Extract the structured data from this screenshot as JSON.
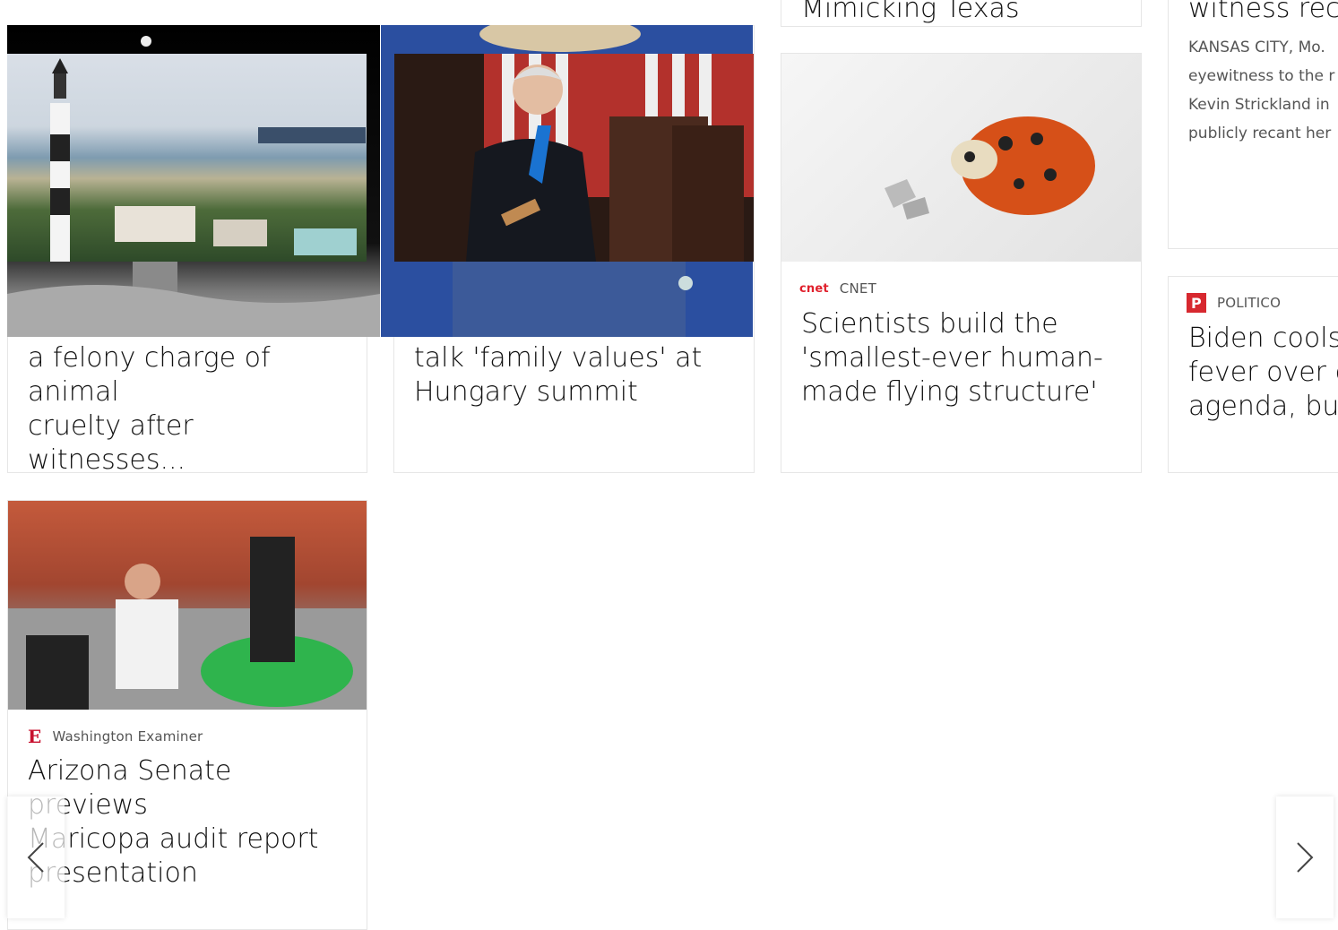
{
  "cards": {
    "texas": {
      "headline_tail": "Mimicking Texas"
    },
    "witness": {
      "headline_tail": "witness reca",
      "summary_lines": [
        "KANSAS CITY, Mo.",
        "eyewitness to the r",
        "Kevin Strickland in",
        "publicly recant her"
      ]
    },
    "animal": {
      "headline_lines": [
        "a felony charge of animal",
        "cruelty after witnesses..."
      ]
    },
    "hungary": {
      "headline_lines": [
        "talk 'family values' at",
        "Hungary summit"
      ]
    },
    "cnet": {
      "source": "CNET",
      "logo_text": "cnet",
      "headline_lines": [
        "Scientists build the",
        "'smallest-ever human-",
        "made flying structure'"
      ]
    },
    "politico": {
      "source": "POLITICO",
      "logo_text": "P",
      "headline_lines": [
        "Biden cools",
        "fever over d",
        "agenda, but"
      ]
    },
    "arizona": {
      "source": "Washington Examiner",
      "logo_text": "E",
      "headline_lines": [
        "Arizona Senate previews",
        "Maricopa audit report",
        "presentation"
      ]
    }
  },
  "nav": {
    "prev_icon": "chevron-left-icon",
    "next_icon": "chevron-right-icon"
  },
  "colors": {
    "cnet_red": "#e0202c",
    "politico_red": "#d7282f",
    "examiner_red": "#c8102e"
  }
}
